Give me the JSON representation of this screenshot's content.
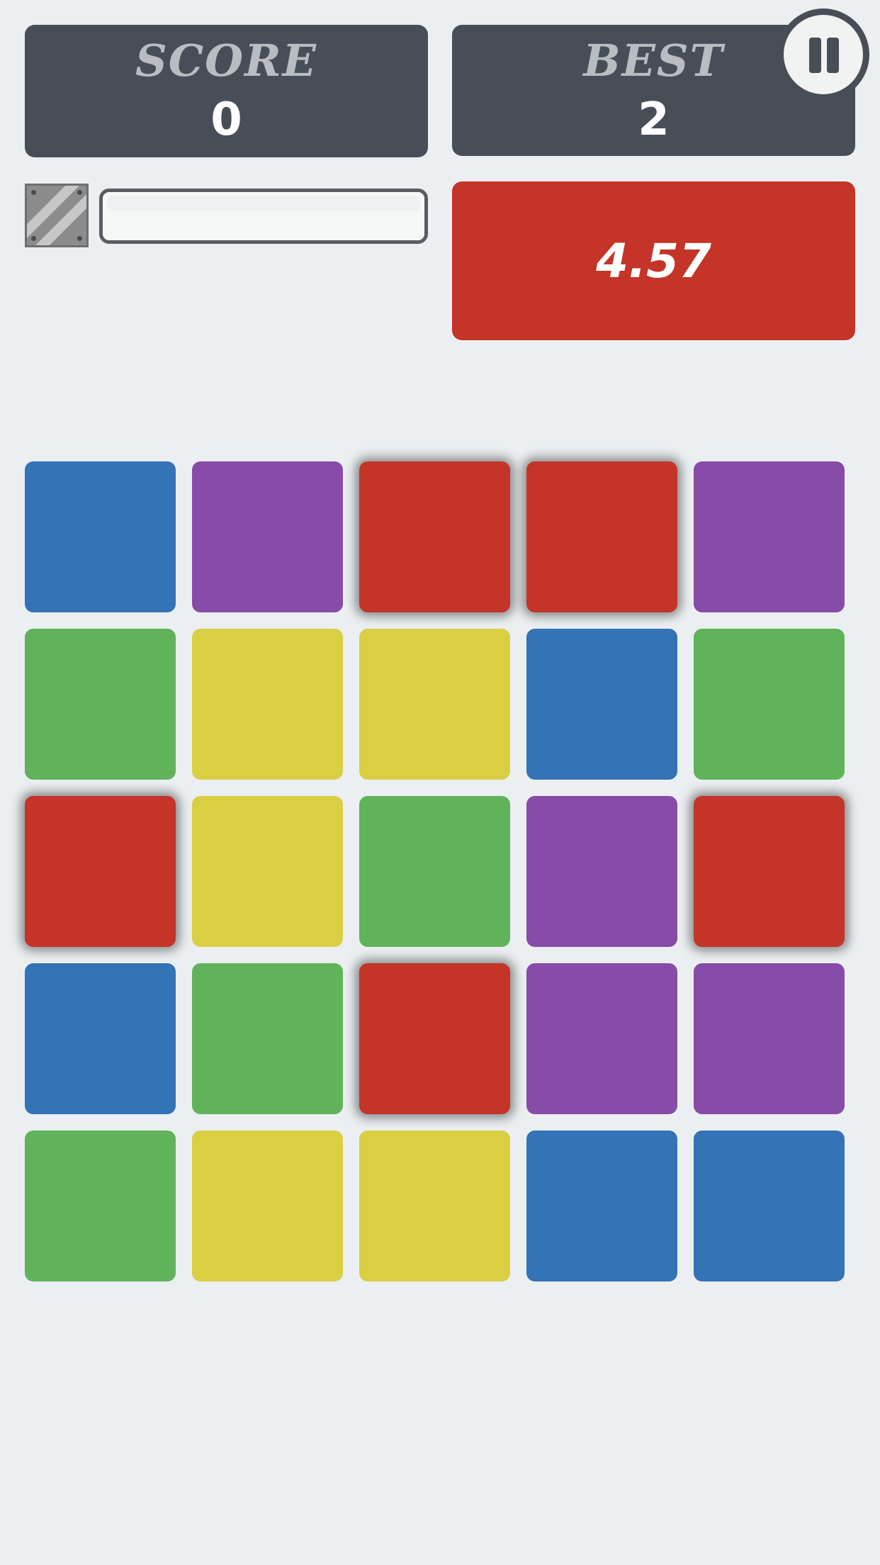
{
  "score": {
    "label": "SCORE",
    "value": "0"
  },
  "best": {
    "label": "BEST",
    "value": "2"
  },
  "timer": {
    "value": "4.57"
  },
  "progress": {
    "fraction": 0
  },
  "icons": {
    "pause": "pause-icon",
    "powerup": "hammer-powerup-icon"
  },
  "colors": {
    "blue": "#3373b6",
    "purple": "#874ba8",
    "red": "#c43428",
    "green": "#60b35a",
    "yellow": "#dace43",
    "panel": "#474e57",
    "background": "#ebeff1"
  },
  "board": {
    "rows": 5,
    "cols": 5,
    "tiles": [
      [
        "blue",
        "purple",
        "red",
        "red",
        "purple"
      ],
      [
        "green",
        "yellow",
        "yellow",
        "blue",
        "green"
      ],
      [
        "red",
        "yellow",
        "green",
        "purple",
        "red"
      ],
      [
        "blue",
        "green",
        "red",
        "purple",
        "purple"
      ],
      [
        "green",
        "yellow",
        "yellow",
        "blue",
        "blue"
      ]
    ],
    "highlighted": [
      [
        0,
        2
      ],
      [
        0,
        3
      ],
      [
        2,
        0
      ],
      [
        2,
        4
      ],
      [
        3,
        2
      ]
    ]
  }
}
